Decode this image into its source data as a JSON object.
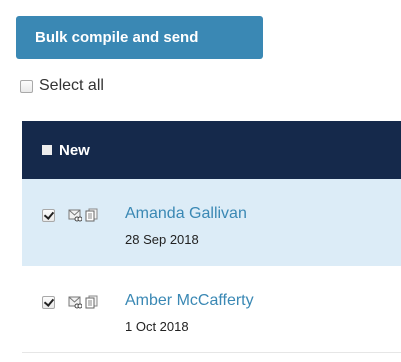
{
  "bulk_button_label": "Bulk compile and send",
  "select_all_label": "Select all",
  "panel": {
    "title": "New",
    "rows": [
      {
        "name": "Amanda Gallivan",
        "date": "28 Sep 2018",
        "checked": true
      },
      {
        "name": "Amber McCafferty",
        "date": "1 Oct 2018",
        "checked": true
      }
    ]
  },
  "colors": {
    "button_bg": "#3a88b4",
    "header_bg": "#15294b",
    "selected_row_bg": "#dcecf7",
    "link": "#3a88b4"
  },
  "icons": [
    "envelope-attachment-icon",
    "document-copy-icon"
  ]
}
